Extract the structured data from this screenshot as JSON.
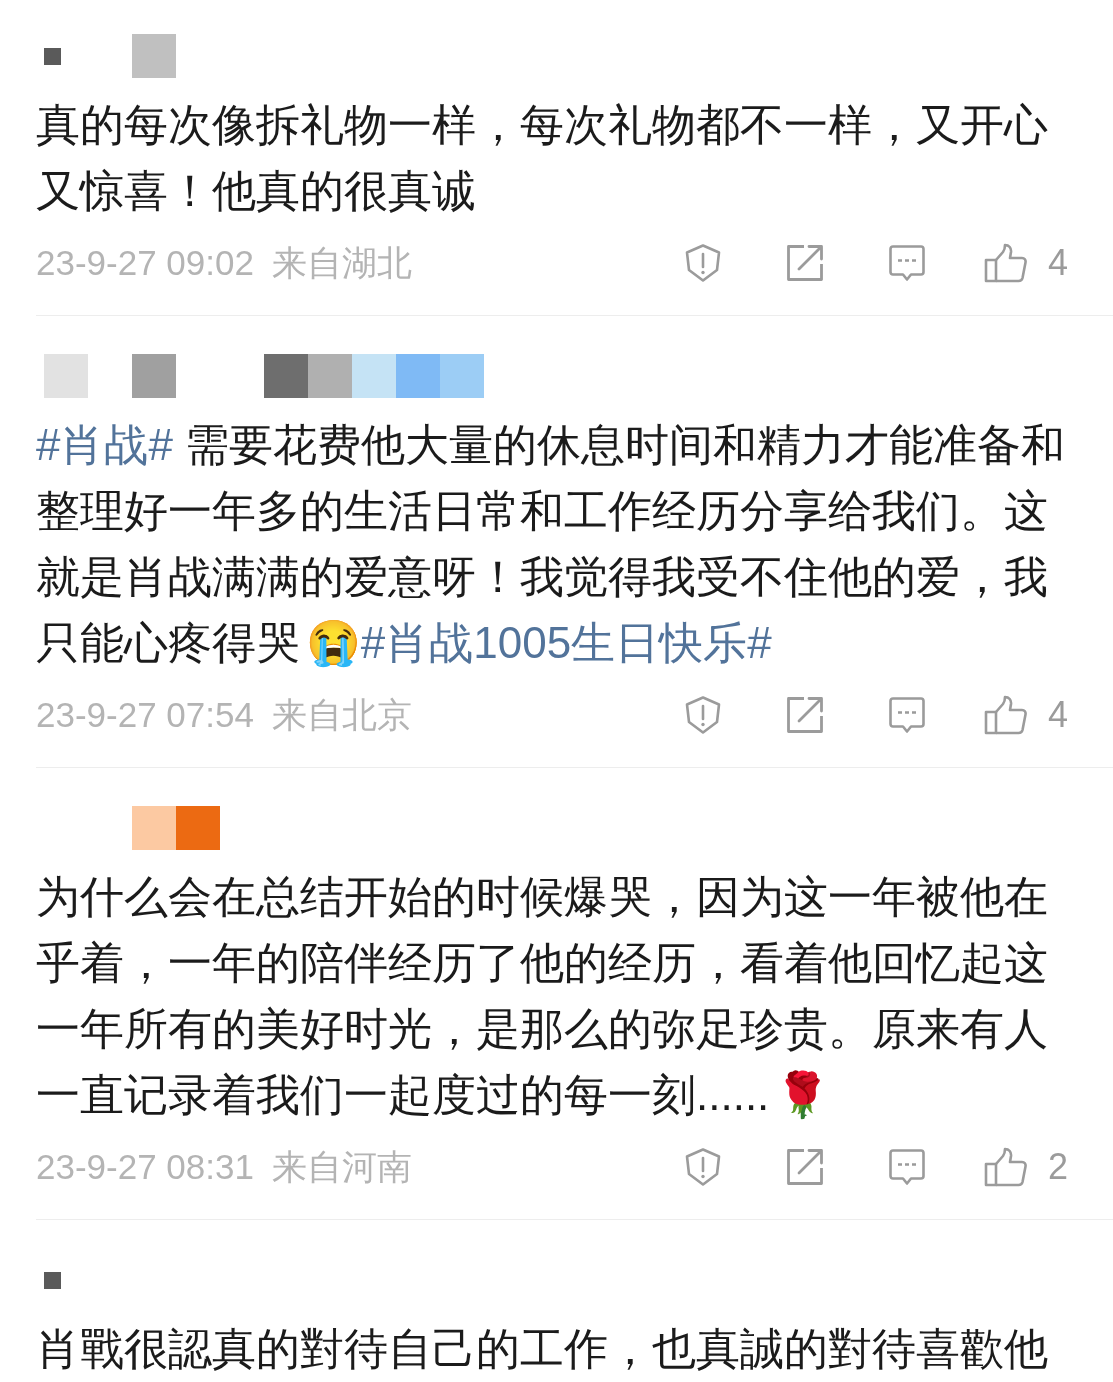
{
  "comments": [
    {
      "name_mosaic": [
        {
          "kind": "dot",
          "color": "#5a5a5a"
        },
        {
          "kind": "gap"
        },
        {
          "kind": "tile",
          "color": "#c0c0c0"
        }
      ],
      "body": [
        {
          "kind": "text",
          "text": "真的每次像拆礼物一样，每次礼物都不一样，又开心又惊喜！他真的很真诚"
        }
      ],
      "time": "23-9-27 09:02",
      "location": "来自湖北",
      "likes": "4"
    },
    {
      "name_mosaic": [
        {
          "kind": "tile",
          "color": "#e2e2e2"
        },
        {
          "kind": "gap"
        },
        {
          "kind": "tile",
          "color": "#a0a0a0"
        },
        {
          "kind": "gap"
        },
        {
          "kind": "gap"
        },
        {
          "kind": "tile",
          "color": "#6e6e6e"
        },
        {
          "kind": "tile",
          "color": "#b0b0b0"
        },
        {
          "kind": "tile",
          "color": "#c5e3f5"
        },
        {
          "kind": "tile",
          "color": "#7fbaf5"
        },
        {
          "kind": "tile",
          "color": "#9ccdf5"
        }
      ],
      "body": [
        {
          "kind": "hashtag",
          "text": "#肖战#"
        },
        {
          "kind": "text",
          "text": " 需要花费他大量的休息时间和精力才能准备和整理好一年多的生活日常和工作经历分享给我们。这就是肖战满满的爱意呀！我觉得我受不住他的爱，我只能心疼得哭"
        },
        {
          "kind": "emoji",
          "text": "😭"
        },
        {
          "kind": "hashtag",
          "text": "#肖战1005生日快乐#"
        }
      ],
      "time": "23-9-27 07:54",
      "location": "来自北京",
      "likes": "4"
    },
    {
      "name_mosaic": [
        {
          "kind": "gap"
        },
        {
          "kind": "gap"
        },
        {
          "kind": "tile",
          "color": "#fcc9a2"
        },
        {
          "kind": "tile",
          "color": "#ec6a12"
        }
      ],
      "body": [
        {
          "kind": "text",
          "text": "为什么会在总结开始的时候爆哭，因为这一年被他在乎着，一年的陪伴经历了他的经历，看着他回忆起这一年所有的美好时光，是那么的弥足珍贵。原来有人一直记录着我们一起度过的每一刻......"
        },
        {
          "kind": "emoji",
          "text": "🌹"
        }
      ],
      "time": "23-9-27 08:31",
      "location": "来自河南",
      "likes": "2"
    },
    {
      "name_mosaic": [
        {
          "kind": "dot",
          "color": "#5a5a5a"
        }
      ],
      "body": [
        {
          "kind": "text",
          "text": "肖戰很認真的對待自己的工作，也真誠的對待喜歡他"
        }
      ]
    }
  ]
}
